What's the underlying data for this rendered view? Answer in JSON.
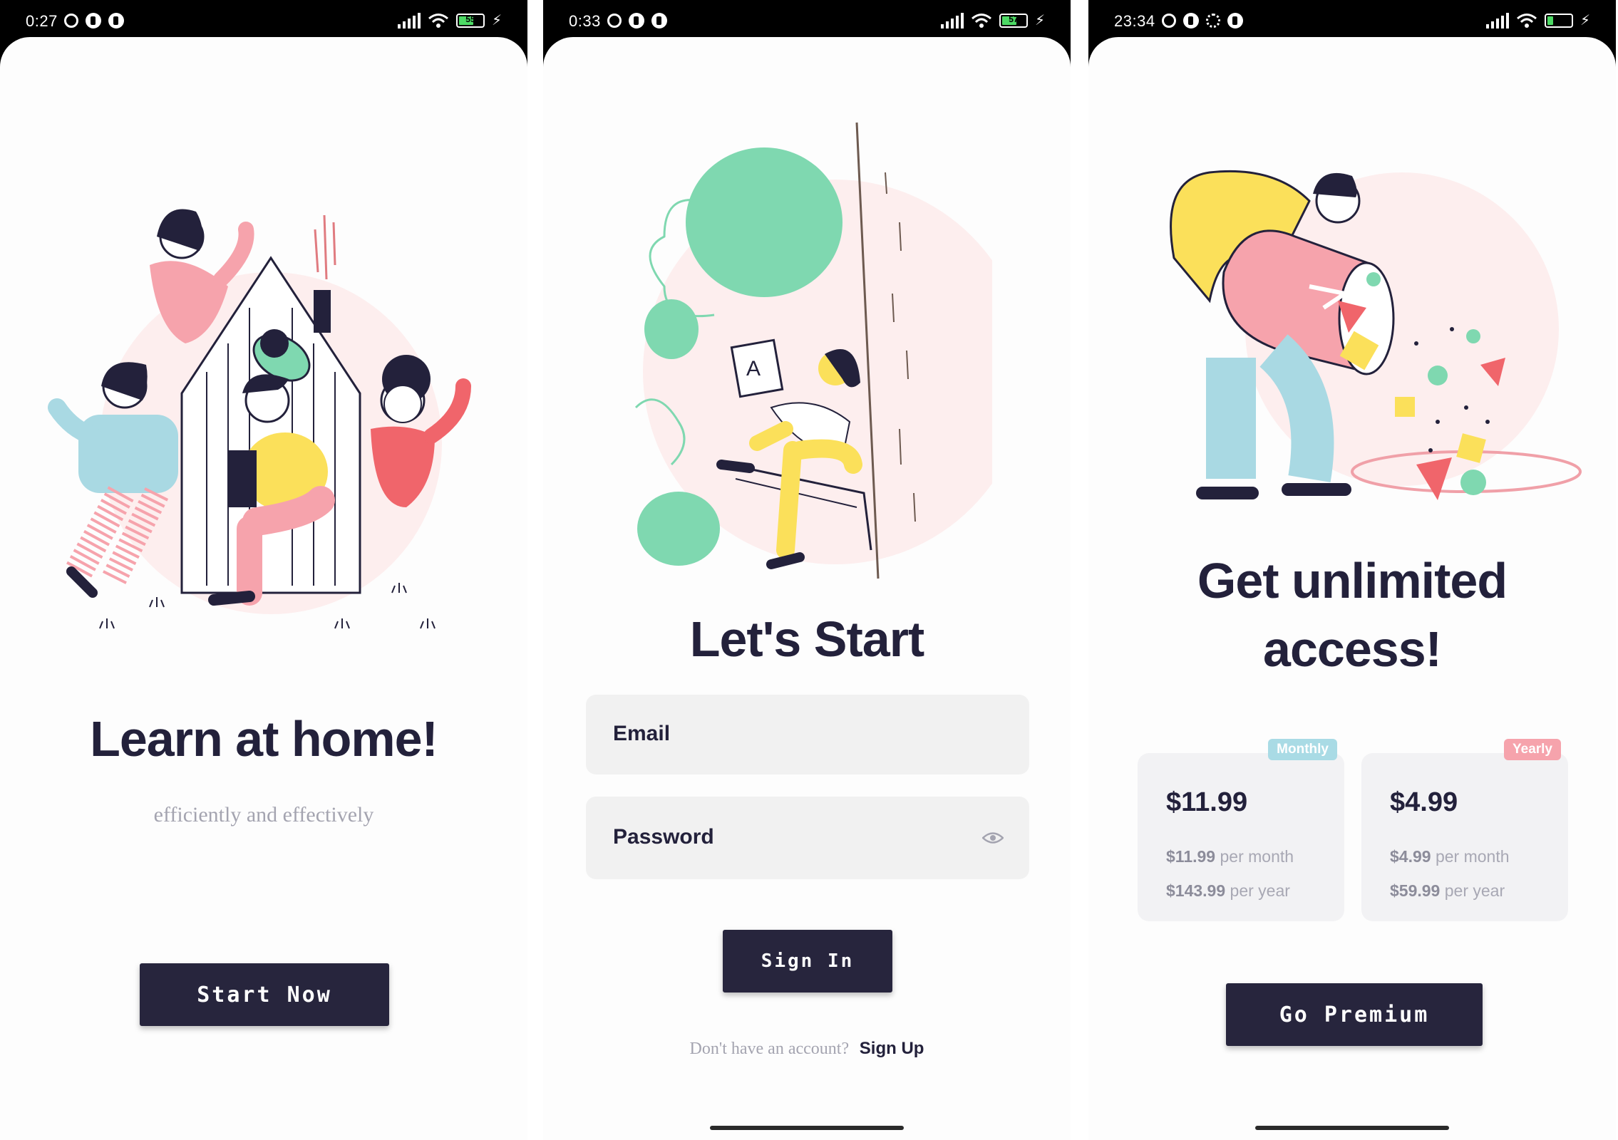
{
  "colors": {
    "ink": "#23213b",
    "button": "#27253d",
    "muted": "#a4a4b0",
    "field_bg": "#f1f1f1",
    "pink_blob": "#fdeeee",
    "green": "#7fd8b0",
    "yellow": "#fbe05a",
    "pink": "#f6a3ac",
    "red": "#f0656b",
    "blue": "#a9d9e3",
    "badge_monthly": "#a9dbe5",
    "badge_yearly": "#f6a3ac"
  },
  "screens": [
    {
      "status": {
        "time": "0:27",
        "battery": "55"
      },
      "title": "Learn at home!",
      "subtitle": "efficiently and effectively",
      "button": "Start Now"
    },
    {
      "status": {
        "time": "0:33",
        "battery": "57"
      },
      "title": "Let's Start",
      "email_label": "Email",
      "password_label": "Password",
      "button": "Sign In",
      "signup_prompt": "Don't have an account?",
      "signup_link": "Sign Up"
    },
    {
      "status": {
        "time": "23:34",
        "battery": "22"
      },
      "title_line1": "Get unlimited",
      "title_line2": "access!",
      "plans": [
        {
          "badge": "Monthly",
          "price": "$11.99",
          "line1_value": "$11.99",
          "line1_unit": "per month",
          "line2_value": "$143.99",
          "line2_unit": "per year"
        },
        {
          "badge": "Yearly",
          "price": "$4.99",
          "line1_value": "$4.99",
          "line1_unit": "per month",
          "line2_value": "$59.99",
          "line2_unit": "per year"
        }
      ],
      "button": "Go Premium"
    }
  ]
}
